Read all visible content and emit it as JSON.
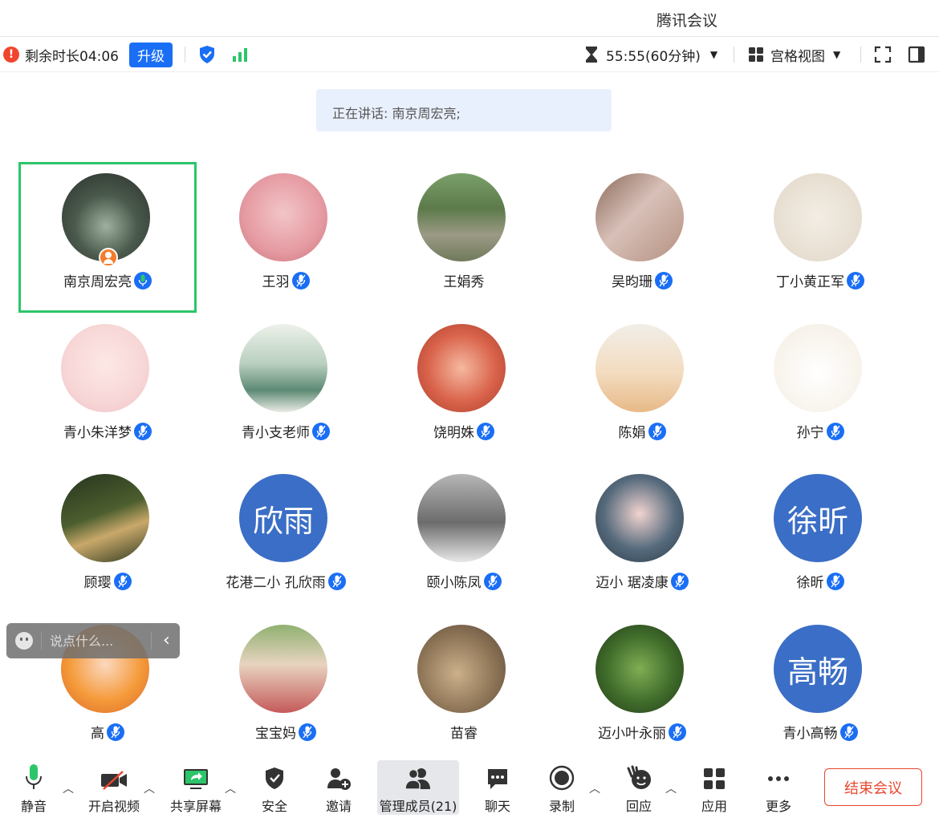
{
  "window": {
    "title": "腾讯会议"
  },
  "topbar": {
    "remaining": "剩余时长04:06",
    "upgrade_label": "升级",
    "timer": "55:55(60分钟)",
    "view_label": "宫格视图"
  },
  "speaking": "正在讲话: 南京周宏亮;",
  "participants": [
    {
      "name": "南京周宏亮",
      "avatar_text": ""
    },
    {
      "name": "王羽",
      "avatar_text": ""
    },
    {
      "name": "王娟秀",
      "avatar_text": ""
    },
    {
      "name": "吴昀珊",
      "avatar_text": ""
    },
    {
      "name": "丁小黄正军",
      "avatar_text": ""
    },
    {
      "name": "青小朱洋梦",
      "avatar_text": ""
    },
    {
      "name": "青小支老师",
      "avatar_text": ""
    },
    {
      "name": "饶明姝",
      "avatar_text": ""
    },
    {
      "name": "陈娟",
      "avatar_text": ""
    },
    {
      "name": "孙宁",
      "avatar_text": ""
    },
    {
      "name": "顾璎",
      "avatar_text": ""
    },
    {
      "name": "花港二小 孔欣雨",
      "avatar_text": "欣雨"
    },
    {
      "name": "颐小陈凤",
      "avatar_text": ""
    },
    {
      "name": "迈小 琚凌康",
      "avatar_text": ""
    },
    {
      "name": "徐昕",
      "avatar_text": "徐昕"
    },
    {
      "name": "高",
      "avatar_text": ""
    },
    {
      "name": "宝宝妈",
      "avatar_text": ""
    },
    {
      "name": "苗睿",
      "avatar_text": ""
    },
    {
      "name": "迈小叶永丽",
      "avatar_text": ""
    },
    {
      "name": "青小高畅",
      "avatar_text": "高畅"
    }
  ],
  "chat": {
    "placeholder": "说点什么..."
  },
  "toolbar": {
    "mute": "静音",
    "video": "开启视频",
    "share": "共享屏幕",
    "security": "安全",
    "invite": "邀请",
    "members": "管理成员(21)",
    "chat": "聊天",
    "record": "录制",
    "react": "回应",
    "apps": "应用",
    "more": "更多",
    "end": "结束会议"
  },
  "colors": {
    "accent": "#1a6ef5",
    "active_border": "#2cc56a",
    "danger": "#e9462f",
    "host_badge": "#f67b2a"
  },
  "icons": [
    "info-icon",
    "shield-check-icon",
    "signal-icon",
    "hourglass-icon",
    "grid-icon",
    "fullscreen-icon",
    "sidebar-icon",
    "mic-icon",
    "video-off-icon",
    "share-screen-icon",
    "shield-icon",
    "add-user-icon",
    "users-icon",
    "chat-icon",
    "record-icon",
    "wave-hand-icon",
    "apps-icon",
    "more-icon",
    "smile-icon",
    "chevron-left-icon"
  ]
}
